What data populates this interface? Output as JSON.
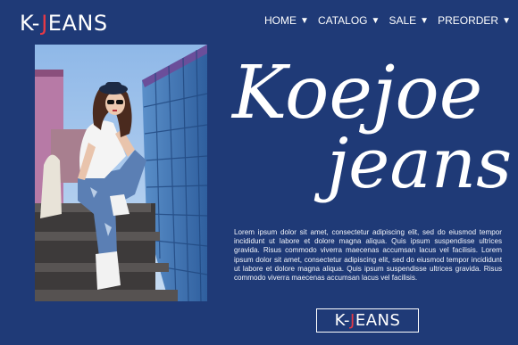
{
  "brand": {
    "left": "K-",
    "accent": "J",
    "right": "EANS",
    "accent_color": "#e63946"
  },
  "nav": {
    "items": [
      {
        "label": "HOME",
        "caret": "▼"
      },
      {
        "label": "CATALOG",
        "caret": "▼"
      },
      {
        "label": "SALE",
        "caret": "▼"
      },
      {
        "label": "PREORDER",
        "caret": "▼"
      }
    ]
  },
  "hero": {
    "title_line1": "Koejoe",
    "title_line2": "jeans",
    "description": "Lorem ipsum dolor sit amet, consectetur adipiscing elit, sed do eiusmod tempor incididunt ut labore et dolore magna aliqua. Quis ipsum suspendisse ultrices gravida. Risus commodo viverra maecenas accumsan lacus vel facilisis. Lorem ipsum dolor sit amet, consectetur adipiscing elit, sed do eiusmod tempor incididunt ut labore et dolore magna aliqua. Quis ipsum suspendisse ultrices gravida. Risus commodo viverra maecenas accumsan lacus vel facilisis."
  },
  "footer_logo": {
    "left": "K-",
    "accent": "J",
    "right": "EANS"
  },
  "colors": {
    "background": "#1f3a77",
    "text": "#ffffff"
  }
}
